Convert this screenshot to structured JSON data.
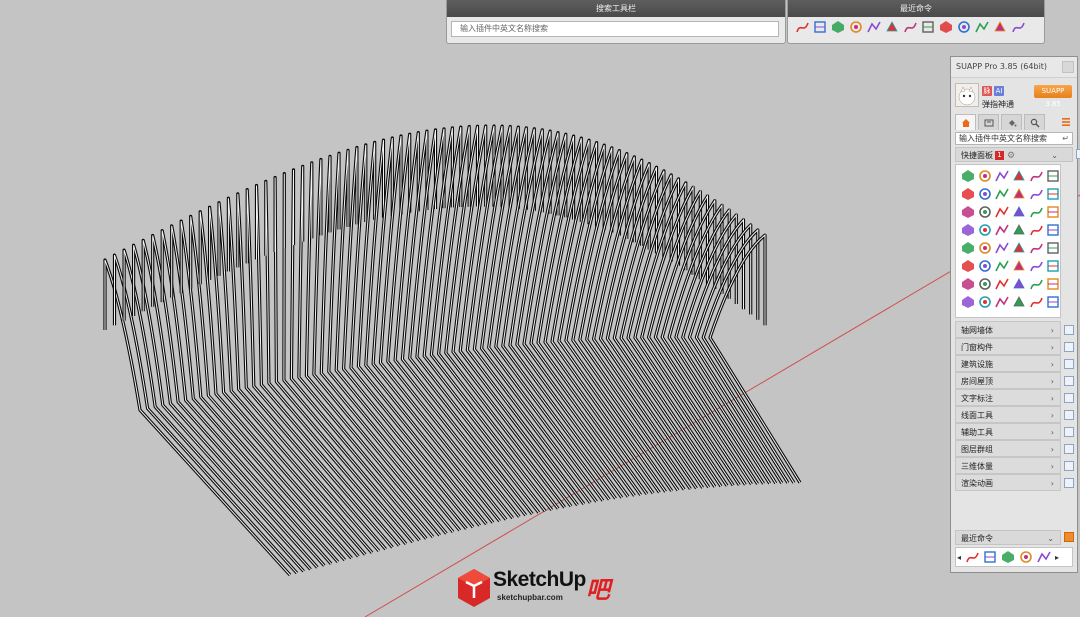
{
  "search_toolbar": {
    "title": "搜索工具栏",
    "placeholder": "输入插件中英文名称搜索"
  },
  "recent_toolbar": {
    "title": "最近命令",
    "icons": [
      "curve-icon",
      "wall-icon",
      "line-tool-icon",
      "hatch-icon",
      "arc-tool-icon",
      "box-select-icon",
      "pipe-icon",
      "stair-icon",
      "layers-icon",
      "stack-icon",
      "shield-icon",
      "gem-icon",
      "arch-icon"
    ]
  },
  "panel": {
    "title": "SUAPP Pro 3.85 (64bit)",
    "user": {
      "name": "弹指神通",
      "badge_vip": "脉",
      "badge_ai": "AI",
      "pro_button": "SUAPP 3.85"
    },
    "tabs": [
      "home-icon",
      "film-icon",
      "paint-bucket-icon",
      "search-icon"
    ],
    "search_value": "输入插件中英文名称搜索",
    "search_enter": "↵",
    "quick_panel": {
      "label": "快捷面板",
      "badge": "1"
    },
    "categories": [
      "轴网墙体",
      "门窗构件",
      "建筑设施",
      "房间屋顶",
      "文字标注",
      "线面工具",
      "辅助工具",
      "图层群组",
      "三维体量",
      "渲染动画"
    ],
    "recent": {
      "label": "最近命令"
    }
  },
  "watermark": {
    "brand": "SketchUp",
    "suffix": "吧",
    "url": "sketchupbar.com"
  },
  "colors": {
    "background": "#c4c4c4",
    "axis_red": "#d05050",
    "accent_orange": "#e7801c"
  }
}
